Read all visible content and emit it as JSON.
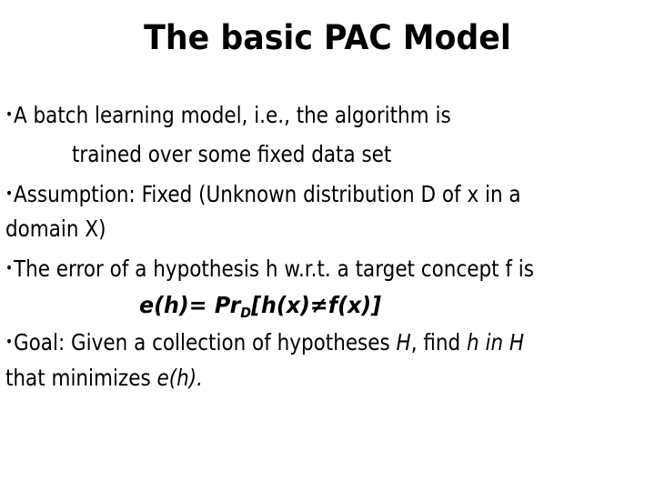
{
  "slide": {
    "title": "The basic PAC Model",
    "bullet_glyph": "•",
    "bullets": [
      {
        "line1": "A batch learning model, i.e., the algorithm is",
        "line2": "trained over some fixed data set"
      },
      {
        "line1": "Assumption: Fixed (Unknown distribution D of x in a",
        "line2": "domain X)"
      },
      {
        "line1": "The error of a hypothesis h w.r.t. a target concept f is",
        "formula": {
          "lhs": "e(h)= Pr",
          "subscript": "D",
          "rhs": "[h(x)≠f(x)]"
        }
      },
      {
        "line1_prefix": "Goal: Given a collection of hypotheses ",
        "line1_H": "H",
        "line1_mid": ", find ",
        "line1_h_in_H": "h in H",
        "line2_prefix": "that minimizes ",
        "line2_eh": "e(h)."
      }
    ]
  }
}
